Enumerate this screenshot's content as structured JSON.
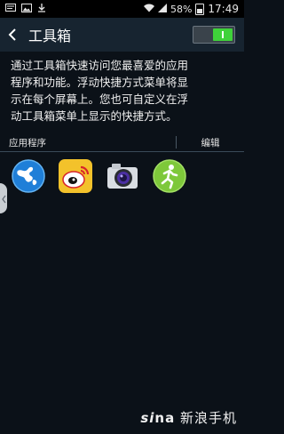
{
  "status_bar": {
    "battery": "58%",
    "time": "17:49"
  },
  "header": {
    "title": "工具箱",
    "toggle_on": true,
    "accent": "#3fd23a"
  },
  "description": {
    "lines": [
      "通过工具箱快速访问您最喜爱的应用",
      "程序和功能。浮动快捷方式菜单将显",
      "示在每个屏幕上。您也可自定义在浮",
      "动工具箱菜单上显示的快捷方式。"
    ]
  },
  "section": {
    "title": "应用程序",
    "edit_label": "编辑"
  },
  "apps": [
    {
      "icon": "internet-globe-icon"
    },
    {
      "icon": "weibo-icon"
    },
    {
      "icon": "camera-icon"
    },
    {
      "icon": "s-health-runner-icon"
    }
  ],
  "watermark": {
    "brand": "si",
    "brand_rest": "na",
    "text": "新浪手机"
  }
}
